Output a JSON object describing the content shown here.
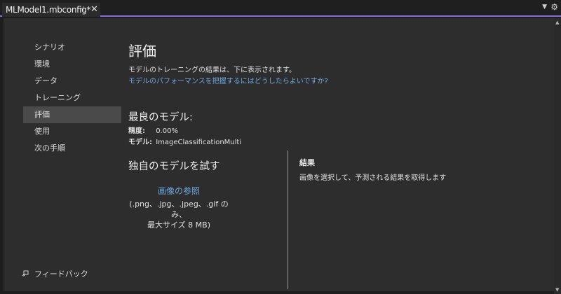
{
  "tab": {
    "title": "MLModel1.mbconfig*",
    "pin_icon": "pin-icon",
    "close_icon": "close-icon"
  },
  "toolbar": {
    "dropdown_icon": "chevron-down-icon",
    "settings_icon": "gear-icon"
  },
  "sidebar": {
    "items": [
      {
        "label": "シナリオ"
      },
      {
        "label": "環境"
      },
      {
        "label": "データ"
      },
      {
        "label": "トレーニング"
      },
      {
        "label": "評価"
      },
      {
        "label": "使用"
      },
      {
        "label": "次の手順"
      }
    ],
    "active_index": 4,
    "feedback_label": "フィードバック",
    "feedback_icon": "feedback-icon"
  },
  "main": {
    "title": "評価",
    "subtitle": "モデルのトレーニングの結果は、下に表示されます。",
    "help_link": "モデルのパフォーマンスを把握するにはどうしたらよいですか?",
    "best_model": {
      "heading": "最良のモデル:",
      "accuracy_label": "精度:",
      "accuracy_value": "0.00%",
      "model_label": "モデル:",
      "model_value": "ImageClassificationMulti"
    },
    "try_model": {
      "heading": "独自のモデルを試す",
      "browse_link": "画像の参照",
      "file_types": ".png、.jpg、.jpeg、.gif のみ、",
      "max_size": "最大サイズ 8 MB)",
      "results_title": "結果",
      "results_desc": "画像を選択して、予測される結果を取得します"
    }
  },
  "colors": {
    "accent": "#8c6cdc",
    "link": "#6ea9e0",
    "background": "#2d2d2d"
  }
}
